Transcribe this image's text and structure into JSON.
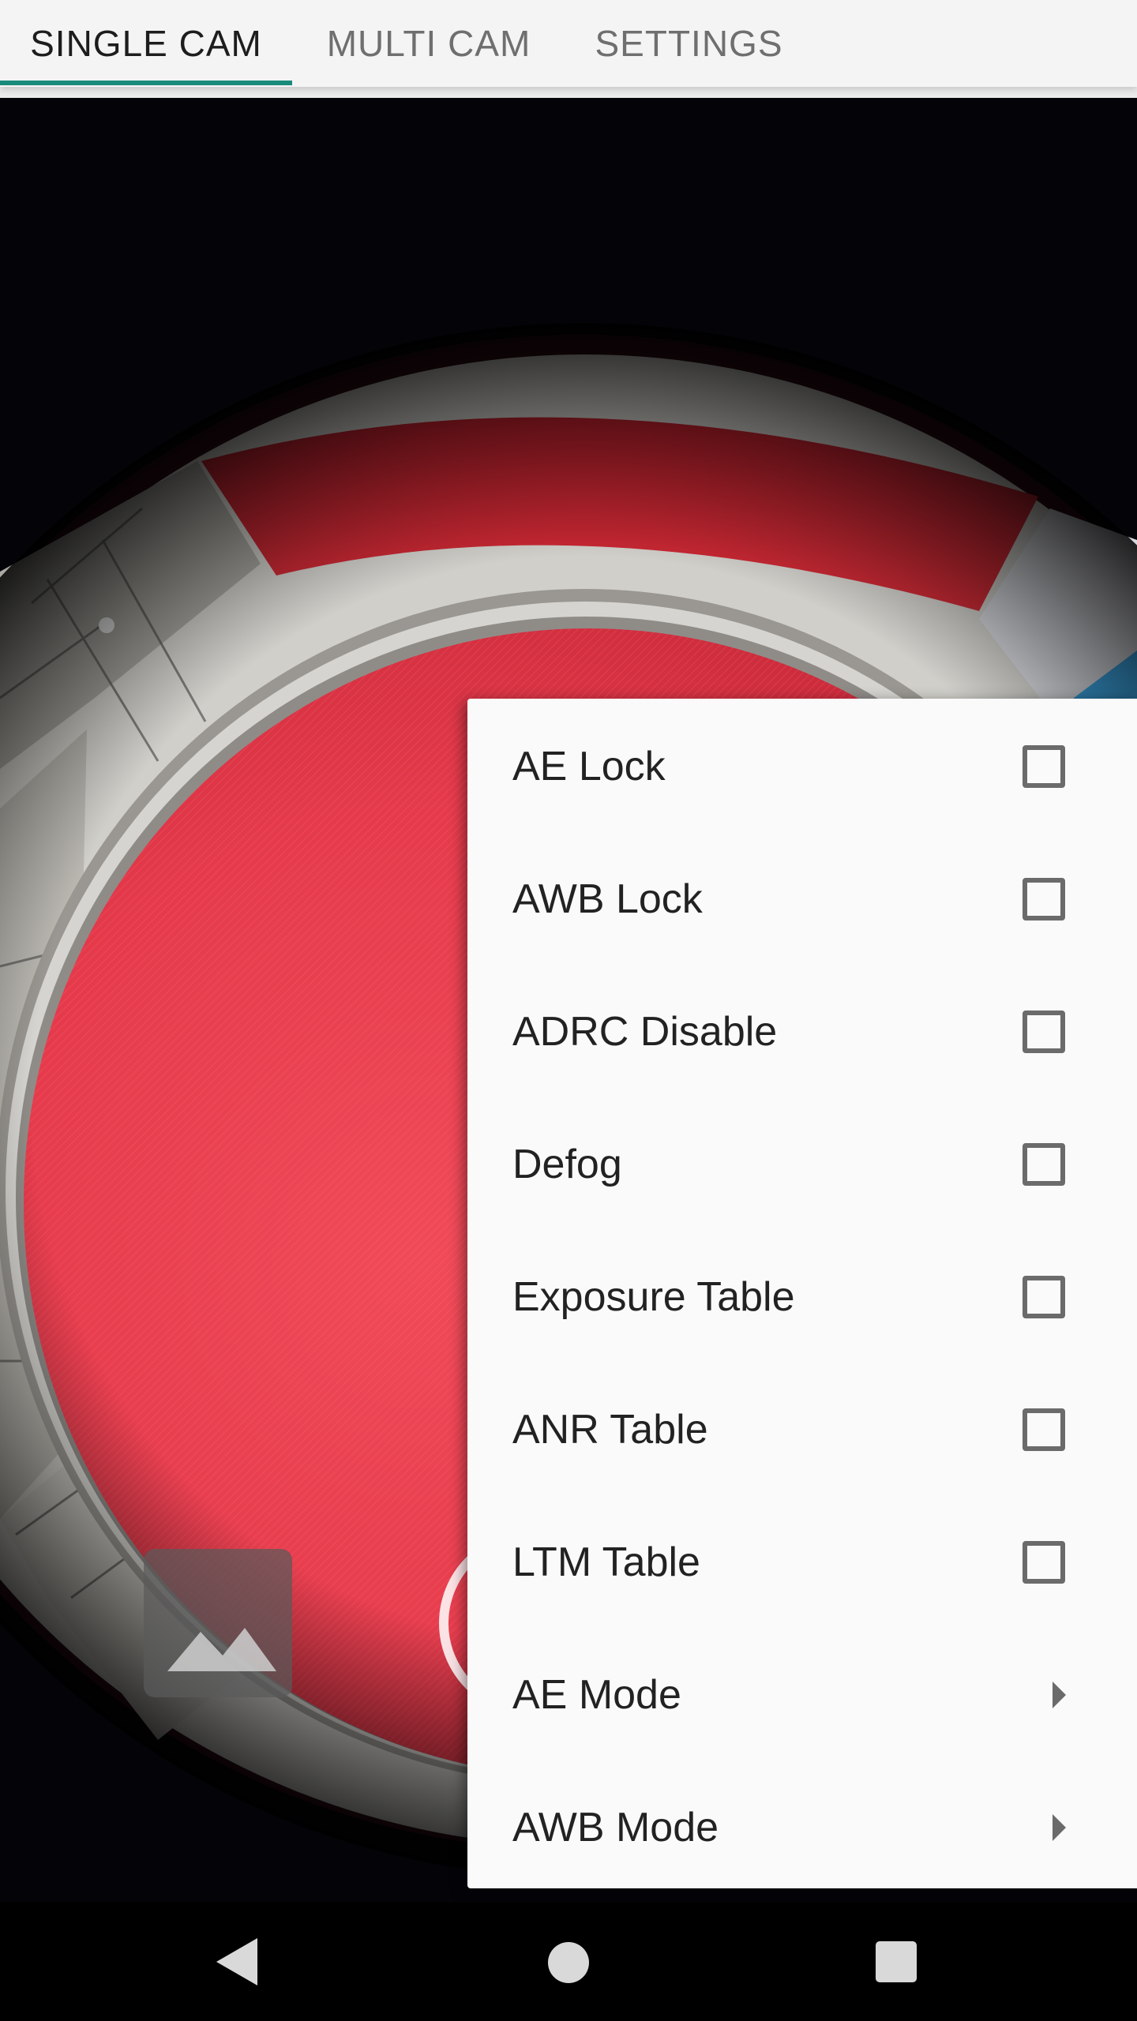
{
  "tabs": [
    {
      "label": "SINGLE CAM",
      "active": true
    },
    {
      "label": "MULTI CAM",
      "active": false
    },
    {
      "label": "SETTINGS",
      "active": false
    }
  ],
  "colors": {
    "accent": "#1a8a7b",
    "tabbar_bg": "#f4f4f4",
    "menu_bg": "#fafafa",
    "preview_red": "#e8394a"
  },
  "preview": {
    "icons": [
      "gallery-thumbnail-icon",
      "shutter-button"
    ]
  },
  "menu": {
    "items": [
      {
        "label": "AE Lock",
        "type": "checkbox",
        "checked": false
      },
      {
        "label": "AWB Lock",
        "type": "checkbox",
        "checked": false
      },
      {
        "label": "ADRC Disable",
        "type": "checkbox",
        "checked": false
      },
      {
        "label": "Defog",
        "type": "checkbox",
        "checked": false
      },
      {
        "label": "Exposure Table",
        "type": "checkbox",
        "checked": false
      },
      {
        "label": "ANR Table",
        "type": "checkbox",
        "checked": false
      },
      {
        "label": "LTM Table",
        "type": "checkbox",
        "checked": false
      },
      {
        "label": "AE Mode",
        "type": "submenu"
      },
      {
        "label": "AWB Mode",
        "type": "submenu"
      }
    ]
  },
  "navbar": {
    "icons": [
      "back-icon",
      "home-icon",
      "recents-icon"
    ]
  }
}
